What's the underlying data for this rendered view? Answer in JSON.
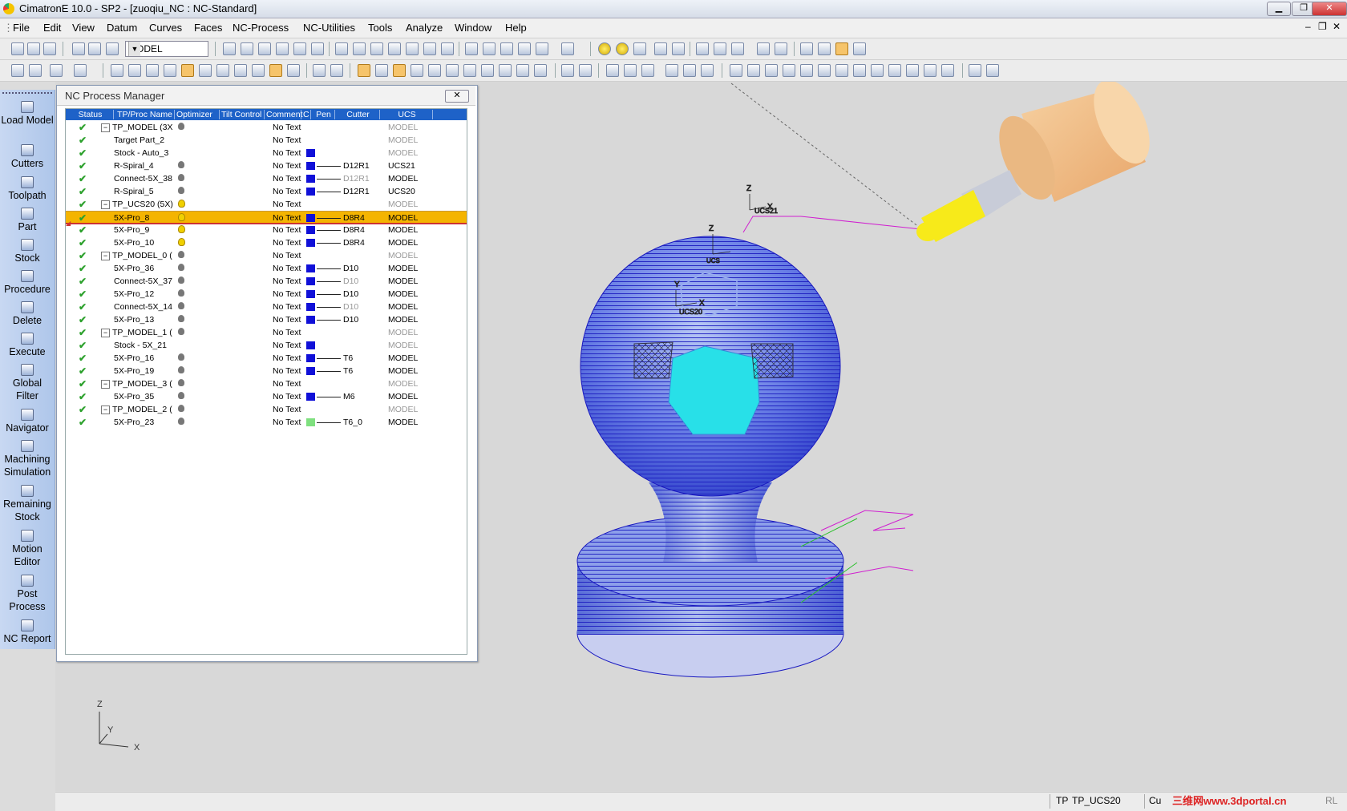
{
  "window": {
    "title": "CimatronE 10.0 - SP2 - [zuoqiu_NC : NC-Standard]"
  },
  "menu": [
    "File",
    "Edit",
    "View",
    "Datum",
    "Curves",
    "Faces",
    "NC-Process",
    "NC-Utilities",
    "Tools",
    "Analyze",
    "Window",
    "Help"
  ],
  "toolbar": {
    "model_combo": "MODEL"
  },
  "sidebar": [
    "Load Model",
    "Cutters",
    "Toolpath",
    "Part",
    "Stock",
    "Procedure",
    "Delete",
    "Execute",
    "Global Filter",
    "Navigator",
    "Machining Simulation",
    "Remaining Stock",
    "Motion Editor",
    "Post Process",
    "NC Report"
  ],
  "panel": {
    "title": "NC Process Manager",
    "columns": [
      "Status",
      "TP/Proc Name",
      "Optimizer",
      "Tilt Control",
      "Comment",
      "C",
      "Pen",
      "Cutter",
      "UCS"
    ],
    "rows": [
      {
        "name": "TP_MODEL (3X",
        "comment": "No Text",
        "cutter": "",
        "ucs": "MODEL",
        "level": 0,
        "expand": "−",
        "bulb": "gray",
        "color": "",
        "grey": true
      },
      {
        "name": "Target Part_2",
        "comment": "No Text",
        "cutter": "",
        "ucs": "MODEL",
        "level": 1,
        "expand": "",
        "bulb": "",
        "color": "",
        "grey": true
      },
      {
        "name": "Stock - Auto_3",
        "comment": "No Text",
        "cutter": "",
        "ucs": "MODEL",
        "level": 1,
        "expand": "",
        "bulb": "",
        "color": "#1010d8",
        "grey": true
      },
      {
        "name": "R-Spiral_4",
        "comment": "No Text",
        "cutter": "D12R1",
        "ucs": "UCS21",
        "level": 1,
        "expand": "",
        "bulb": "gray",
        "color": "#1010d8",
        "grey": false
      },
      {
        "name": "Connect-5X_38",
        "comment": "No Text",
        "cutter": "D12R1",
        "ucs": "MODEL",
        "level": 1,
        "expand": "",
        "bulb": "gray",
        "color": "#1010d8",
        "grey": false,
        "cgrey": true
      },
      {
        "name": "R-Spiral_5",
        "comment": "No Text",
        "cutter": "D12R1",
        "ucs": "UCS20",
        "level": 1,
        "expand": "",
        "bulb": "gray",
        "color": "#1010d8",
        "grey": false
      },
      {
        "name": "TP_UCS20 (5X)",
        "comment": "No Text",
        "cutter": "",
        "ucs": "MODEL",
        "level": 0,
        "expand": "−",
        "bulb": "yellow",
        "color": "",
        "grey": true
      },
      {
        "name": "5X-Pro_8",
        "comment": "No Text",
        "cutter": "D8R4",
        "ucs": "MODEL",
        "level": 1,
        "expand": "",
        "bulb": "yellow",
        "color": "#1010d8",
        "grey": false,
        "selected": true
      },
      {
        "name": "5X-Pro_9",
        "comment": "No Text",
        "cutter": "D8R4",
        "ucs": "MODEL",
        "level": 1,
        "expand": "",
        "bulb": "yellow",
        "color": "#1010d8",
        "grey": false
      },
      {
        "name": "5X-Pro_10",
        "comment": "No Text",
        "cutter": "D8R4",
        "ucs": "MODEL",
        "level": 1,
        "expand": "",
        "bulb": "yellow",
        "color": "#1010d8",
        "grey": false
      },
      {
        "name": "TP_MODEL_0 (",
        "comment": "No Text",
        "cutter": "",
        "ucs": "MODEL",
        "level": 0,
        "expand": "−",
        "bulb": "gray",
        "color": "",
        "grey": true
      },
      {
        "name": "5X-Pro_36",
        "comment": "No Text",
        "cutter": "D10",
        "ucs": "MODEL",
        "level": 1,
        "expand": "",
        "bulb": "gray",
        "color": "#1010d8",
        "grey": false
      },
      {
        "name": "Connect-5X_37",
        "comment": "No Text",
        "cutter": "D10",
        "ucs": "MODEL",
        "level": 1,
        "expand": "",
        "bulb": "gray",
        "color": "#1010d8",
        "grey": false,
        "cgrey": true
      },
      {
        "name": "5X-Pro_12",
        "comment": "No Text",
        "cutter": "D10",
        "ucs": "MODEL",
        "level": 1,
        "expand": "",
        "bulb": "gray",
        "color": "#1010d8",
        "grey": false
      },
      {
        "name": "Connect-5X_14",
        "comment": "No Text",
        "cutter": "D10",
        "ucs": "MODEL",
        "level": 1,
        "expand": "",
        "bulb": "gray",
        "color": "#1010d8",
        "grey": false,
        "cgrey": true
      },
      {
        "name": "5X-Pro_13",
        "comment": "No Text",
        "cutter": "D10",
        "ucs": "MODEL",
        "level": 1,
        "expand": "",
        "bulb": "gray",
        "color": "#1010d8",
        "grey": false
      },
      {
        "name": "TP_MODEL_1 (",
        "comment": "No Text",
        "cutter": "",
        "ucs": "MODEL",
        "level": 0,
        "expand": "−",
        "bulb": "gray",
        "color": "",
        "grey": true
      },
      {
        "name": "Stock - 5X_21",
        "comment": "No Text",
        "cutter": "",
        "ucs": "MODEL",
        "level": 1,
        "expand": "",
        "bulb": "",
        "color": "#1010d8",
        "grey": true
      },
      {
        "name": "5X-Pro_16",
        "comment": "No Text",
        "cutter": "T6",
        "ucs": "MODEL",
        "level": 1,
        "expand": "",
        "bulb": "gray",
        "color": "#1010d8",
        "grey": false
      },
      {
        "name": "5X-Pro_19",
        "comment": "No Text",
        "cutter": "T6",
        "ucs": "MODEL",
        "level": 1,
        "expand": "",
        "bulb": "gray",
        "color": "#1010d8",
        "grey": false
      },
      {
        "name": "TP_MODEL_3 (",
        "comment": "No Text",
        "cutter": "",
        "ucs": "MODEL",
        "level": 0,
        "expand": "−",
        "bulb": "gray",
        "color": "",
        "grey": true
      },
      {
        "name": "5X-Pro_35",
        "comment": "No Text",
        "cutter": "M6",
        "ucs": "MODEL",
        "level": 1,
        "expand": "",
        "bulb": "gray",
        "color": "#1010d8",
        "grey": false
      },
      {
        "name": "TP_MODEL_2 (",
        "comment": "No Text",
        "cutter": "",
        "ucs": "MODEL",
        "level": 0,
        "expand": "−",
        "bulb": "gray",
        "color": "",
        "grey": true
      },
      {
        "name": "5X-Pro_23",
        "comment": "No Text",
        "cutter": "T6_0",
        "ucs": "MODEL",
        "level": 1,
        "expand": "",
        "bulb": "gray",
        "color": "#7fe07f",
        "grey": false
      }
    ]
  },
  "viewport": {
    "ucs_labels": [
      "UCS21",
      "UCS20",
      "UCS"
    ],
    "axis_labels": {
      "z": "Z",
      "y": "Y",
      "x": "X"
    }
  },
  "status": {
    "tp_label": "TP",
    "tp_value": "TP_UCS20",
    "cu": "Cu",
    "rl": "RL"
  },
  "watermark": "三维网www.3dportal.cn",
  "colors": {
    "selection": "#f4b400",
    "header": "#1e62c8",
    "toolpath": "#2a2ad8",
    "sphere_face": "#28e0e8",
    "cutter_body": "#f5c48a",
    "cutter_tip": "#f7ea1a"
  }
}
